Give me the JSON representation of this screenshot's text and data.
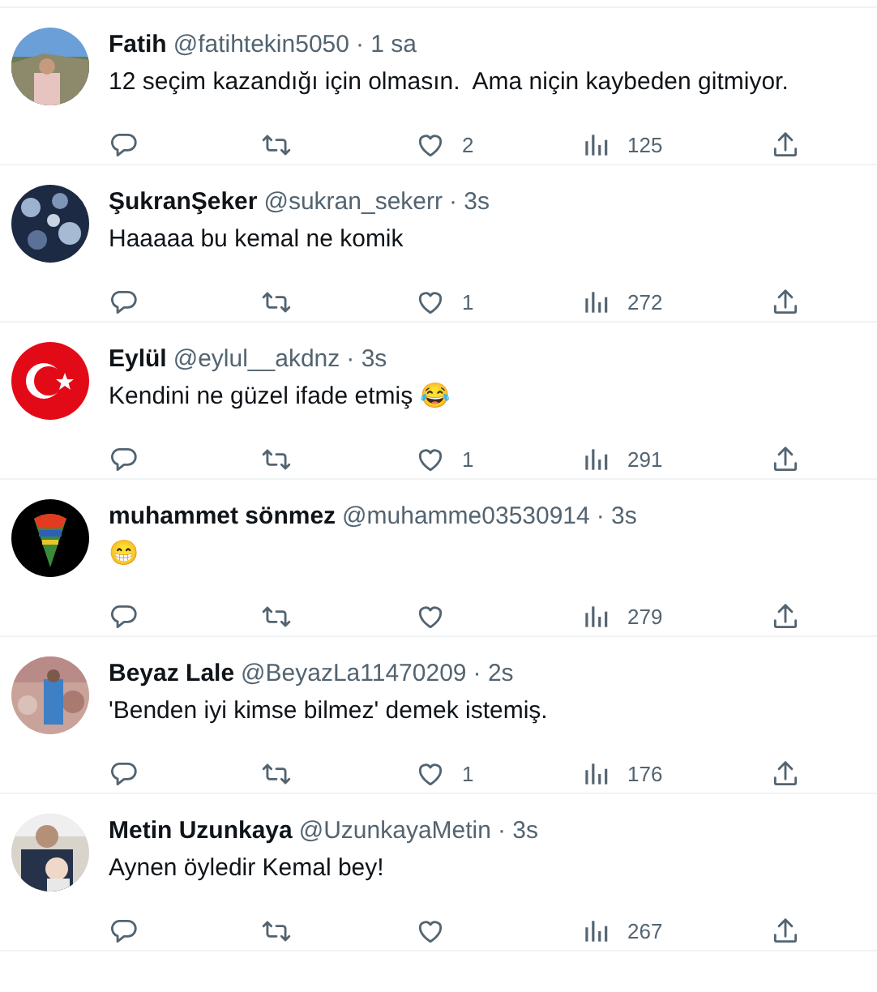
{
  "replies": [
    {
      "name": "Fatih",
      "handle": "@fatihtekin5050",
      "time": "· 1 sa",
      "text": "12 seçim kazandığı için olmasın.  Ama niçin kaybeden gitmiyor.",
      "likes": "2",
      "views": "125"
    },
    {
      "name": "ŞukranŞeker",
      "handle": "@sukran_sekerr",
      "time": "· 3s",
      "text": "Haaaaa bu kemal ne komik",
      "likes": "1",
      "views": "272"
    },
    {
      "name": "Eylül",
      "handle": "@eylul__akdnz",
      "time": "· 3s",
      "text": "Kendini ne güzel ifade etmiş 😂",
      "likes": "1",
      "views": "291"
    },
    {
      "name": "muhammet sönmez",
      "handle": "@muhamme03530914",
      "time": "· 3s",
      "text": "😁",
      "views": "279"
    },
    {
      "name": "Beyaz Lale",
      "handle": "@BeyazLa11470209",
      "time": "· 2s",
      "text": "'Benden iyi kimse bilmez' demek istemiş.",
      "likes": "1",
      "views": "176"
    },
    {
      "name": "Metin Uzunkaya",
      "handle": "@UzunkayaMetin",
      "time": "· 3s",
      "text": "Aynen öyledir Kemal bey!",
      "views": "267"
    }
  ]
}
